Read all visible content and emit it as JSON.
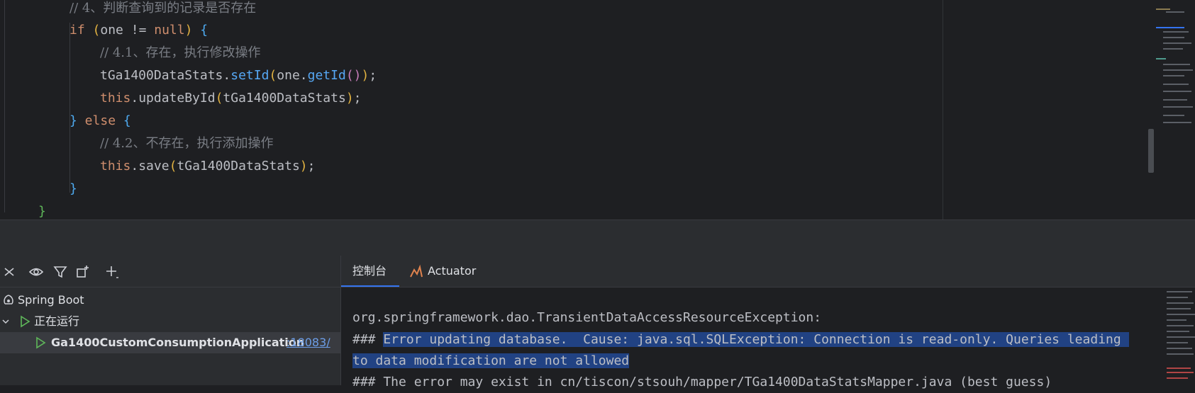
{
  "editor": {
    "lines": [
      {
        "id": "l1",
        "text": "// 4、判断查询到的记录是否存在"
      },
      {
        "id": "l2",
        "kw_if": "if",
        "open_paren": "(",
        "cond_var": "one",
        "op": " != ",
        "kw_null": "null",
        "close_paren": ")",
        "brace": "{"
      },
      {
        "id": "l3",
        "text": "// 4.1、存在，执行修改操作"
      },
      {
        "id": "l4",
        "obj": "tGa1400DataStats.",
        "method": "setId",
        "p1": "(",
        "arg": "one.",
        "inner": "getId",
        "p2": "()",
        "p3": ")",
        "semi": ";"
      },
      {
        "id": "l5",
        "kw_this": "this",
        "dot": ".",
        "method": "updateById",
        "p1": "(",
        "arg": "tGa1400DataStats",
        "p2": ")",
        "semi": ";"
      },
      {
        "id": "l6",
        "close": "}",
        "kw_else": " else ",
        "open": "{"
      },
      {
        "id": "l7",
        "text": "// 4.2、不存在，执行添加操作"
      },
      {
        "id": "l8",
        "kw_this": "this",
        "dot": ".",
        "method": "save",
        "p1": "(",
        "arg": "tGa1400DataStats",
        "p2": ")",
        "semi": ";"
      },
      {
        "id": "l9",
        "text": "}"
      },
      {
        "id": "l10",
        "text": "}"
      }
    ]
  },
  "services": {
    "tree": {
      "root": "Spring Boot",
      "group": "正在运行",
      "app_name": "Ga1400CustomConsumptionApplication",
      "app_port": ":18083/"
    }
  },
  "console": {
    "tabs": [
      {
        "label": "控制台",
        "active": true
      },
      {
        "label": "Actuator",
        "active": false
      }
    ],
    "lines": {
      "l1": "org.springframework.dao.TransientDataAccessResourceException:",
      "l2_prefix": "### ",
      "l2_selected": "Error updating database.  Cause: java.sql.SQLException: Connection is read-only. Queries leading ",
      "l3_selected": "to data modification are not allowed",
      "l4": "### The error may exist in cn/tiscon/stsouh/mapper/TGa1400DataStatsMapper.java (best guess)"
    }
  },
  "colors": {
    "editor_bg": "#1e1f22",
    "panel_bg": "#2b2d30",
    "keyword": "#cf8e6d",
    "comment": "#7a7e85",
    "method": "#56a8f5",
    "selection": "#214283",
    "accent": "#3574f0"
  }
}
